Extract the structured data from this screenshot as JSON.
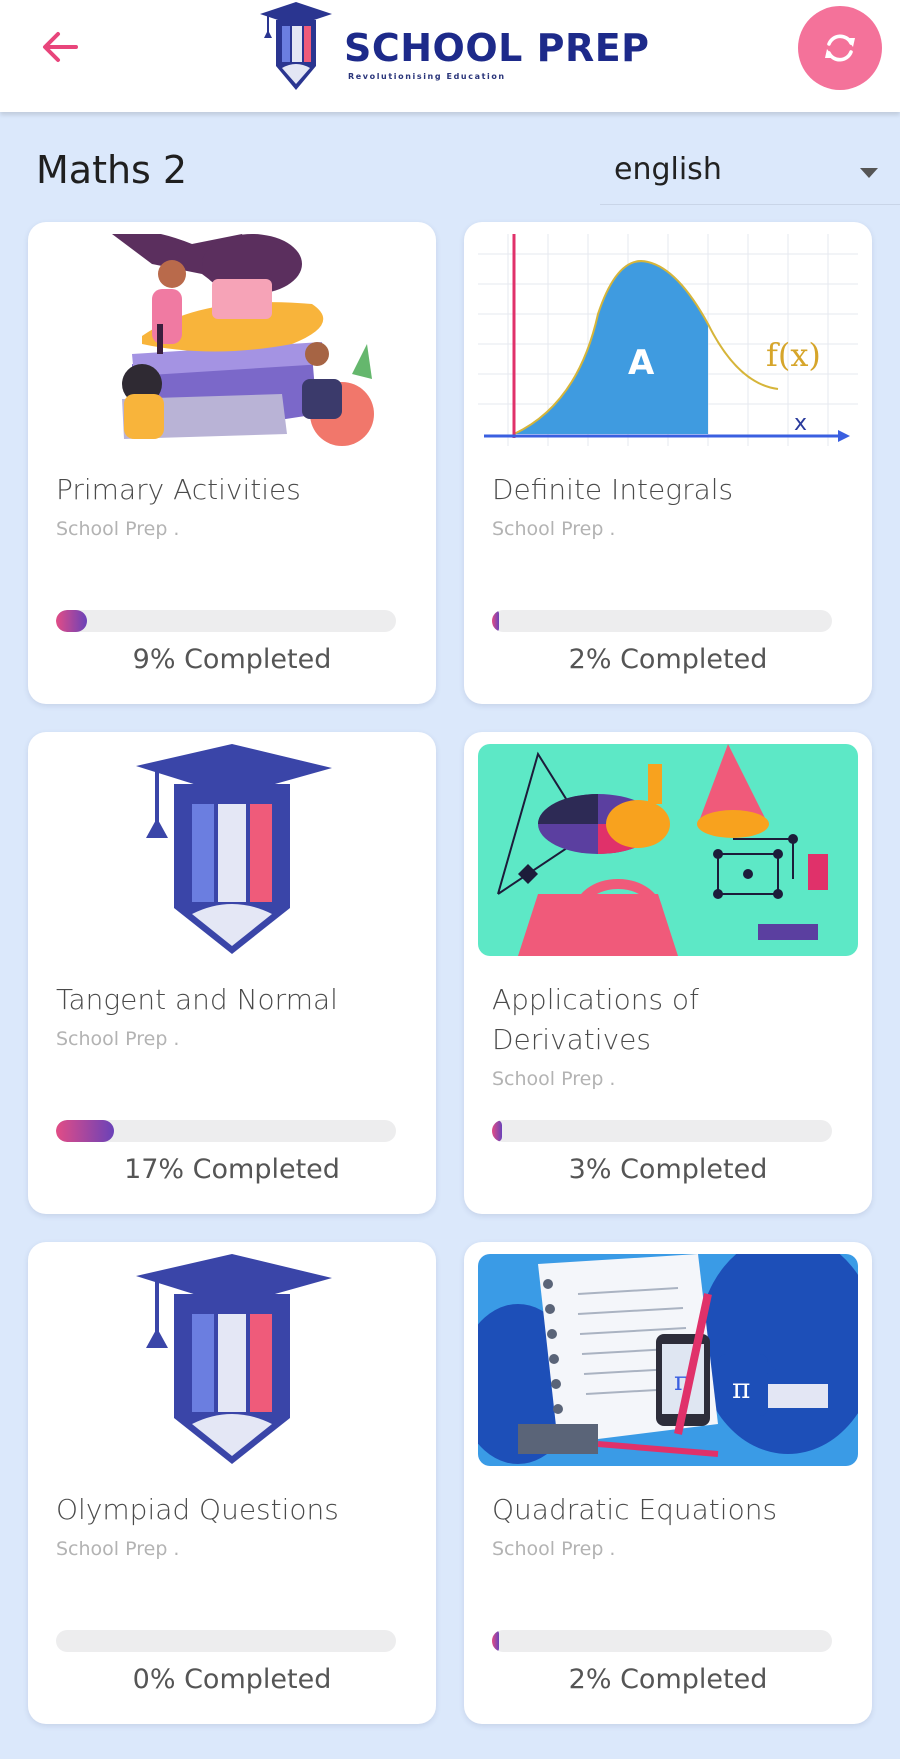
{
  "header": {
    "back_icon": "arrow-left-icon",
    "brand_title": "SCHOOL PREP",
    "brand_tagline": "Revolutionising Education",
    "refresh_icon": "refresh-icon",
    "colors": {
      "accent": "#f4729a",
      "brand": "#1d2a8a",
      "back_arrow": "#e8457b"
    }
  },
  "page": {
    "title": "Maths 2",
    "language": {
      "selected": "english",
      "caret_icon": "caret-down-icon"
    }
  },
  "courses": [
    {
      "title": "Primary Activities",
      "provider": "School Prep .",
      "progress": 9,
      "progress_label": "9% Completed",
      "thumbnail": "reading-kids-illustration"
    },
    {
      "title": "Definite Integrals",
      "provider": "School Prep .",
      "progress": 2,
      "progress_label": "2% Completed",
      "thumbnail": "area-under-curve-graph"
    },
    {
      "title": "Tangent and Normal",
      "provider": "School Prep .",
      "progress": 17,
      "progress_label": "17% Completed",
      "thumbnail": "school-prep-logo"
    },
    {
      "title": "Applications of Derivatives",
      "provider": "School Prep .",
      "progress": 3,
      "progress_label": "3% Completed",
      "thumbnail": "geometry-shapes-illustration"
    },
    {
      "title": "Olympiad Questions",
      "provider": "School Prep .",
      "progress": 0,
      "progress_label": "0% Completed",
      "thumbnail": "school-prep-logo"
    },
    {
      "title": "Quadratic Equations",
      "provider": "School Prep .",
      "progress": 2,
      "progress_label": "2% Completed",
      "thumbnail": "notebook-pi-mug-illustration"
    }
  ],
  "graph_labels": {
    "area": "A",
    "function": "f(x)",
    "axis": "x"
  },
  "pi_symbol": "π",
  "colors": {
    "background": "#dbe8fb",
    "progress_start": "#e24c86",
    "progress_end": "#6a42b8",
    "track": "#ededee"
  }
}
